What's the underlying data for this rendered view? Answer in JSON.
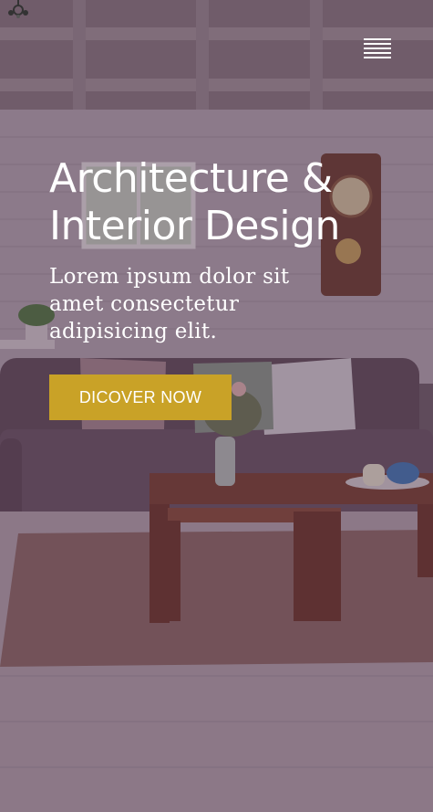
{
  "hero": {
    "title_line1": "Architecture &",
    "title_line2": "Interior Design",
    "subtitle": "Lorem ipsum dolor sit amet consectetur adipisicing elit.",
    "cta_label": "DICOVER NOW"
  },
  "header": {
    "menu_icon": "hamburger-menu-icon",
    "logo_icon": "chandelier-icon"
  },
  "colors": {
    "accent": "#c9a227",
    "overlay": "#46304a",
    "text": "#ffffff"
  }
}
